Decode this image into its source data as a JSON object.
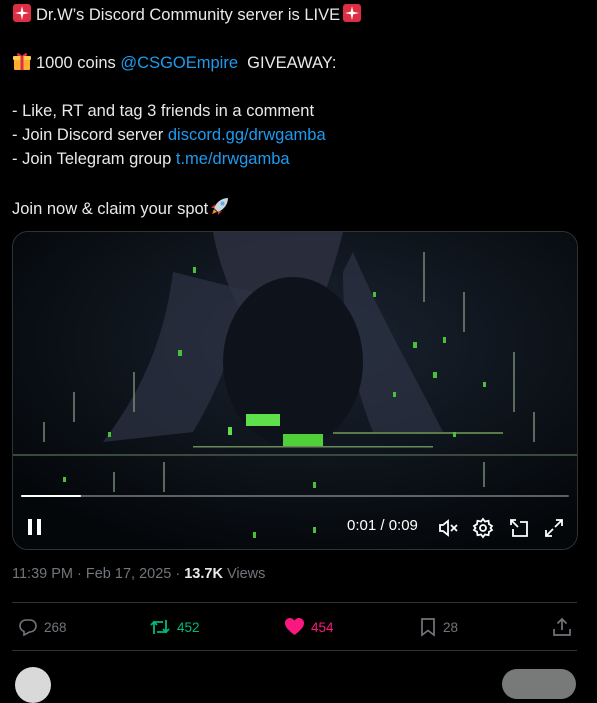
{
  "tweet": {
    "line1": "Dr.W’s Discord Community server is LIVE",
    "giveaway_prefix": "1000 coins ",
    "giveaway_mention": "@CSGOEmpire",
    "giveaway_suffix": "  GIVEAWAY:",
    "step1": "- Like, RT and tag 3 friends in a comment",
    "step2_text": "- Join Discord server ",
    "step2_link": "discord.gg/drwgamba",
    "step3_text": "- Join Telegram group ",
    "step3_link": "t.me/drwgamba",
    "cta": "Join now & claim your spot"
  },
  "video": {
    "time": "0:01 / 0:09",
    "progress": 0.11
  },
  "meta": {
    "timestamp": "11:39 PM · Feb 17, 2025 · ",
    "views_count": "13.7K",
    "views_label": " Views"
  },
  "actions": {
    "replies": "268",
    "reposts": "452",
    "likes": "454",
    "bookmarks": "28"
  },
  "colors": {
    "link": "#1d9bf0",
    "repost": "#00ba7c",
    "like": "#f91880",
    "muted": "#71767b"
  },
  "icons": [
    "siren-icon",
    "gift-icon",
    "rocket-icon",
    "pause-icon",
    "volume-muted-icon",
    "settings-icon",
    "popout-icon",
    "fullscreen-icon",
    "reply-icon",
    "repost-icon",
    "heart-icon",
    "bookmark-icon",
    "share-icon"
  ]
}
